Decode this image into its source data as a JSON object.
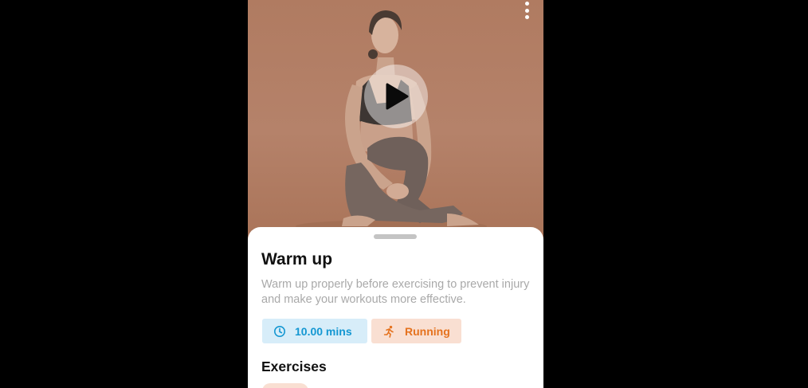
{
  "hero": {
    "more_icon": "more-vertical-icon",
    "play_icon": "play-icon"
  },
  "sheet": {
    "title": "Warm up",
    "description": "Warm up properly before exercising to prevent injury and make your workouts more effective.",
    "duration": {
      "icon": "clock-icon",
      "label": "10.00 mins"
    },
    "category": {
      "icon": "running-icon",
      "label": "Running"
    },
    "section_title": "Exercises"
  },
  "colors": {
    "hero_background": "#b47d62",
    "duration_chip_bg": "#d7edf9",
    "duration_chip_text": "#1497d2",
    "category_chip_bg": "#f9dfd2",
    "category_chip_text": "#e5721e"
  }
}
